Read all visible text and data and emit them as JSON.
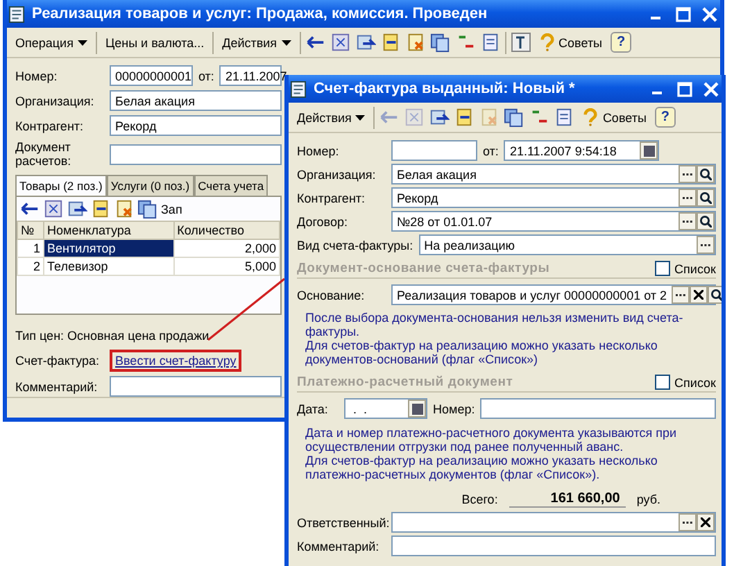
{
  "back_window": {
    "title": "Реализация товаров и услуг: Продажа, комиссия. Проведен",
    "menu": [
      {
        "label": "Операция",
        "dropdown": true
      },
      {
        "label": "Цены и валюта...",
        "dropdown": false
      },
      {
        "label": "Действия",
        "dropdown": true
      }
    ],
    "tips": "Советы",
    "help": "?",
    "number_label": "Номер:",
    "number": "00000000001",
    "date_label": "от:",
    "date": "21.11.2007",
    "fields": [
      {
        "label": "Организация:",
        "value": "Белая акация"
      },
      {
        "label": "Контрагент:",
        "value": "Рекорд"
      },
      {
        "label": "Документ расчетов:"
      }
    ],
    "tabs": [
      {
        "label": "Товары (2 поз.)",
        "selected": true
      },
      {
        "label": "Услуги (0 поз.)",
        "selected": false
      },
      {
        "label": "Счета учета",
        "selected": false
      }
    ],
    "table_toolbar_text": "Зап",
    "table": {
      "columns": [
        "№",
        "Номенклатура",
        "Количество"
      ],
      "rows": [
        {
          "num": "1",
          "name": "Вентилятор",
          "qty": "2,000",
          "selected": true
        },
        {
          "num": "2",
          "name": "Телевизор",
          "qty": "5,000",
          "selected": false
        }
      ]
    },
    "price_type": "Тип цен: Основная цена продажи",
    "invoice_label": "Счет-фактура:",
    "invoice_link": "Ввести счет-фактуру",
    "comment_label": "Комментарий:"
  },
  "front_window": {
    "title": "Счет-фактура выданный: Новый *",
    "menu": [
      {
        "label": "Действия",
        "dropdown": true
      }
    ],
    "tips": "Советы",
    "help": "?",
    "number_label": "Номер:",
    "date_label": "от:",
    "date": "21.11.2007  9:54:18",
    "fields": [
      {
        "label": "Организация:",
        "value": "Белая акация"
      },
      {
        "label": "Контрагент:",
        "value": "Рекорд"
      },
      {
        "label": "Договор:",
        "value": "№28 от 01.01.07"
      }
    ],
    "invoice_type_label": "Вид счета-фактуры:",
    "invoice_type": "На реализацию",
    "basis_section": {
      "title": "Документ-основание счета-фактуры",
      "list_label": "Список",
      "list_checked": false
    },
    "basis_label": "Основание:",
    "basis_value": "Реализация товаров и услуг 00000000001 от 2",
    "basis_notes": [
      "После выбора документа-основания нельзя изменить вид счета-фактуры.",
      "Для счетов-фактур на реализацию можно указать несколько документов-оснований (флаг «Список»)"
    ],
    "payment_section": {
      "title": "Платежно-расчетный документ",
      "list_label": "Список",
      "list_checked": false
    },
    "pay_date_label": "Дата:",
    "pay_date": " .  .",
    "pay_number_label": "Номер:",
    "payment_notes": [
      "Дата и номер платежно-расчетного документа указываются при осуществлении отгрузки под ранее полученный аванс.",
      "Для счетов-фактур на реализацию можно указать несколько платежно-расчетных документов (флаг «Список»)."
    ],
    "total_label": "Всего:",
    "total": "161 660,00",
    "currency": "руб.",
    "responsible_label": "Ответственный:",
    "comment_label": "Комментарий:"
  }
}
